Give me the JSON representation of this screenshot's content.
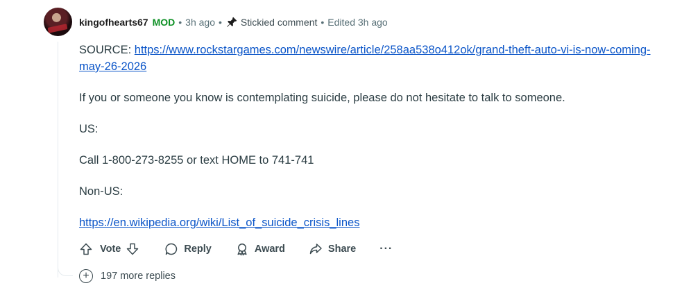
{
  "comment": {
    "username": "kingofhearts67",
    "mod_badge": "MOD",
    "time": "3h ago",
    "stickied_label": "Stickied comment",
    "edited": "Edited 3h ago",
    "separator": "•",
    "paragraphs": {
      "source_prefix": "SOURCE: ",
      "source_link": "https://www.rockstargames.com/newswire/article/258aa538o412ok/grand-theft-auto-vi-is-now-coming-may-26-2026",
      "message": "If you or someone you know is contemplating suicide, please do not hesitate to talk to someone.",
      "us_label": "US:",
      "us_contact": "Call 1-800-273-8255 or text HOME to 741-741",
      "non_us_label": "Non-US:",
      "non_us_link": "https://en.wikipedia.org/wiki/List_of_suicide_crisis_lines"
    }
  },
  "actions": {
    "vote": "Vote",
    "reply": "Reply",
    "award": "Award",
    "share": "Share",
    "more": "···"
  },
  "more_replies": {
    "plus": "+",
    "label": "197 more replies"
  },
  "icons": {
    "upvote": "arrow-up-icon",
    "downvote": "arrow-down-icon",
    "reply": "speech-bubble-icon",
    "award": "award-ribbon-icon",
    "share": "share-arrow-icon",
    "pin": "pin-icon",
    "plus": "plus-circle-icon"
  },
  "colors": {
    "mod": "#0a8f22",
    "link": "#0b55c8",
    "meta": "#576f76"
  }
}
